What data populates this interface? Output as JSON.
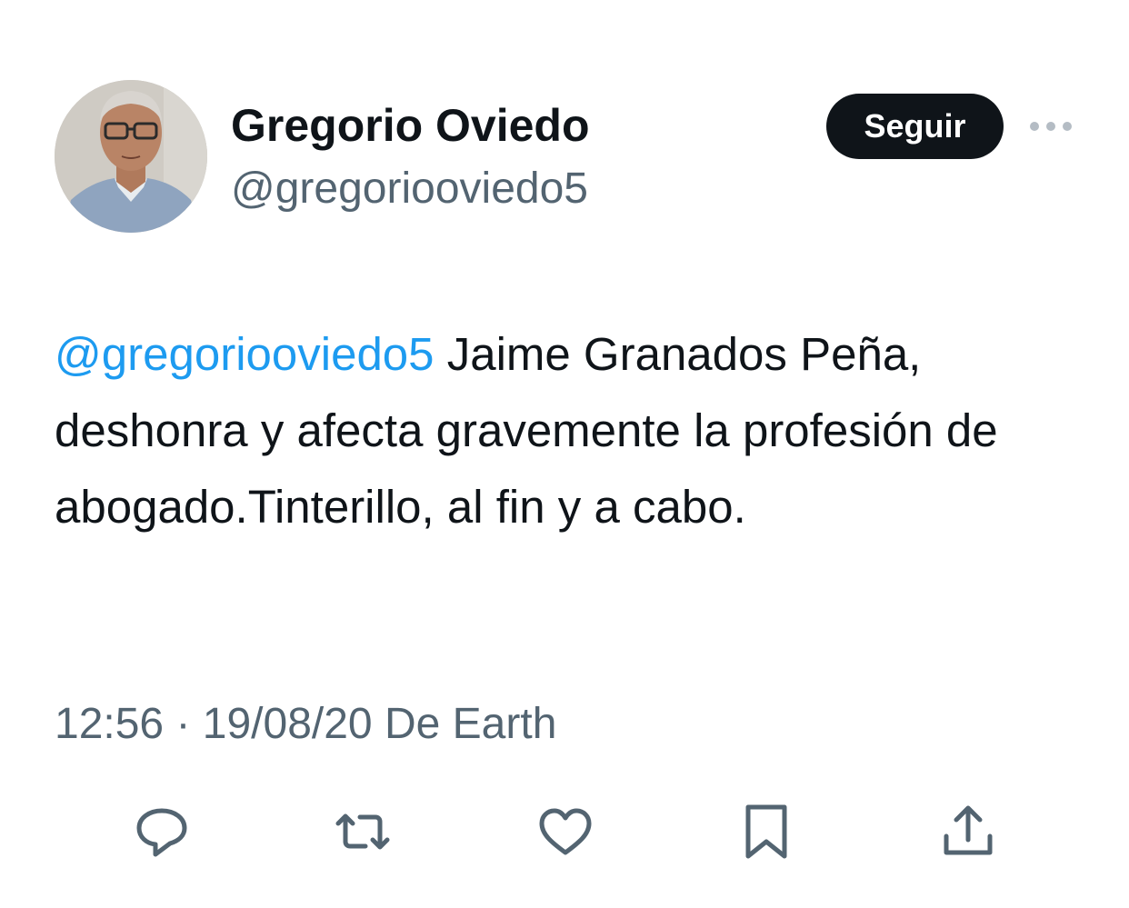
{
  "author": {
    "display_name": "Gregorio Oviedo",
    "handle": "@gregoriooviedo5"
  },
  "follow_button": {
    "label": "Seguir"
  },
  "more_icon": "more-horizontal-icon",
  "tweet": {
    "mention": "@gregoriooviedo5",
    "text": " Jaime Granados Peña, deshonra y afecta gravemente la profesión de abogado.Tinterillo, al fin y a cabo."
  },
  "meta": {
    "time": "12:56",
    "separator": " · ",
    "date": "19/08/20",
    "source": " De Earth"
  },
  "actions": [
    {
      "icon": "reply-icon"
    },
    {
      "icon": "retweet-icon"
    },
    {
      "icon": "like-icon"
    },
    {
      "icon": "bookmark-icon"
    },
    {
      "icon": "share-icon"
    }
  ],
  "colors": {
    "text_primary": "#0f1419",
    "text_secondary": "#536471",
    "link": "#1d9bf0",
    "button_bg": "#0f1419",
    "button_text": "#ffffff",
    "icon": "#536471"
  }
}
